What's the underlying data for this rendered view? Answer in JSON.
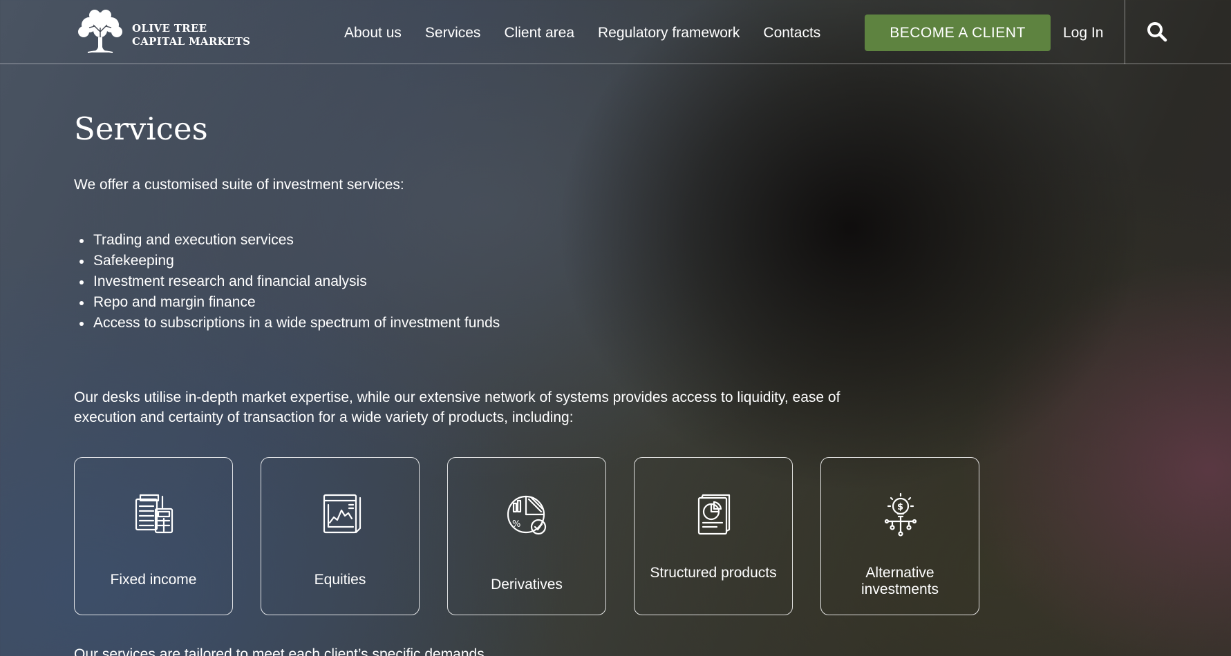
{
  "brand": {
    "line1": "OLIVE TREE",
    "line2": "CAPITAL MARKETS",
    "accent_color": "#5e8340"
  },
  "nav": {
    "items": [
      {
        "label": "About us"
      },
      {
        "label": "Services"
      },
      {
        "label": "Client area"
      },
      {
        "label": "Regulatory framework"
      },
      {
        "label": "Contacts"
      }
    ],
    "cta_label": "BECOME A CLIENT",
    "login_label": "Log In",
    "search_icon": "search-icon"
  },
  "main": {
    "title": "Services",
    "intro": "We offer a customised suite of investment services:",
    "services": [
      "Trading and execution services",
      "Safekeeping",
      "Investment research and financial analysis",
      "Repo and margin finance",
      "Access to subscriptions in a wide spectrum of investment funds"
    ],
    "desk_text": "Our desks utilise in-depth market expertise, while our extensive network of systems provides access to liquidity, ease of execution and certainty of transaction for a wide variety of products, including:",
    "products": [
      {
        "label": "Fixed income",
        "icon": "documents-calculator-icon"
      },
      {
        "label": "Equities",
        "icon": "chart-report-icon"
      },
      {
        "label": "Derivatives",
        "icon": "pie-chart-percent-icon"
      },
      {
        "label": "Structured products",
        "icon": "report-pie-icon"
      },
      {
        "label": "Alternative investments",
        "icon": "idea-dollar-icon"
      }
    ],
    "tail_text": "Our services are tailored to meet each client’s specific demands."
  }
}
